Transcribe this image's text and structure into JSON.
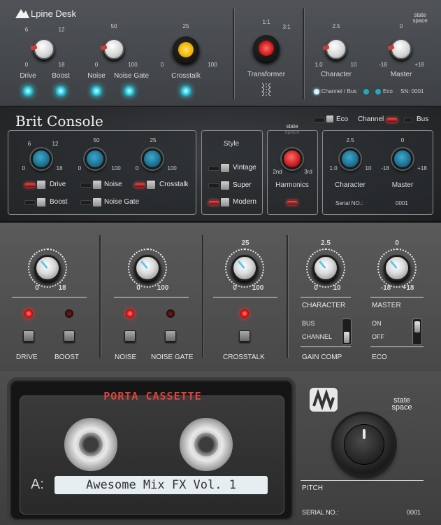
{
  "top": {
    "brand": "Lpine Desk",
    "drive": {
      "label": "Drive",
      "min": "0",
      "mid": "6",
      "max": "18"
    },
    "boost": {
      "label": "Boost",
      "tick": "12"
    },
    "noise": {
      "label": "Noise",
      "min": "0",
      "top": "50",
      "max": "100"
    },
    "noise_gate": {
      "label": "Noise Gate"
    },
    "crosstalk": {
      "label": "Crosstalk",
      "min": "0",
      "top": "25",
      "max": "100"
    },
    "transformer": {
      "label": "Transformer",
      "left": "1:1",
      "right": "3:1"
    },
    "character": {
      "label": "Character",
      "top": "2.5",
      "min": "1.0",
      "max": "10"
    },
    "master": {
      "label": "Master",
      "top": "0",
      "min": "-18",
      "max": "+18"
    },
    "brand2": "state space",
    "channel_bus": "Channel / Bus",
    "eco": "Eco",
    "sn": "SN: 0001",
    "accent": "#38d6ea"
  },
  "brit": {
    "title": "Brit Console",
    "eco": "Eco",
    "channel": "Channel",
    "bus": "Bus",
    "brand": "state space",
    "drive": {
      "top": "6",
      "tick": "12",
      "min": "0",
      "max": "18",
      "label": "Drive"
    },
    "boost": "Boost",
    "noise": {
      "top": "50",
      "min": "0",
      "max": "100",
      "label": "Noise"
    },
    "noise_gate": "Noise Gate",
    "crosstalk": {
      "top": "25",
      "min": "0",
      "max": "100",
      "label": "Crosstalk"
    },
    "style": {
      "title": "Style",
      "options": [
        "Vintage",
        "Super",
        "Modern"
      ]
    },
    "harmonics": {
      "label": "Harmonics",
      "min": "2nd",
      "max": "3rd"
    },
    "character": {
      "top": "2.5",
      "min": "1.0",
      "max": "10",
      "label": "Character"
    },
    "master": {
      "top": "0",
      "min": "-18",
      "max": "+18",
      "label": "Master"
    },
    "serial_label": "Serial NO.:",
    "serial_value": "0001"
  },
  "desk": {
    "drive": {
      "min": "0",
      "max": "18",
      "label": "DRIVE"
    },
    "boost": "BOOST",
    "noise": {
      "min": "0",
      "max": "100",
      "label": "NOISE"
    },
    "noise_gate": "NOISE GATE",
    "crosstalk": {
      "top": "25",
      "min": "0",
      "max": "100",
      "label": "CROSSTALK"
    },
    "character": {
      "top": "2.5",
      "min": "0",
      "max": "10",
      "label": "CHARACTER"
    },
    "master": {
      "top": "0",
      "min": "-18",
      "max": "+18",
      "label": "MASTER"
    },
    "gain_comp": {
      "title": "GAIN COMP",
      "up": "BUS",
      "down": "CHANNEL"
    },
    "eco": {
      "title": "ECO",
      "up": "ON",
      "down": "OFF"
    }
  },
  "cassette": {
    "title": "PORTA CASSETTE",
    "side": "A:",
    "label": "Awesome Mix FX Vol. 1",
    "brand": "state space",
    "pitch_label": "PITCH",
    "serial_label": "SERIAL NO.:",
    "serial_value": "0001",
    "title_color": "#e0433b"
  }
}
